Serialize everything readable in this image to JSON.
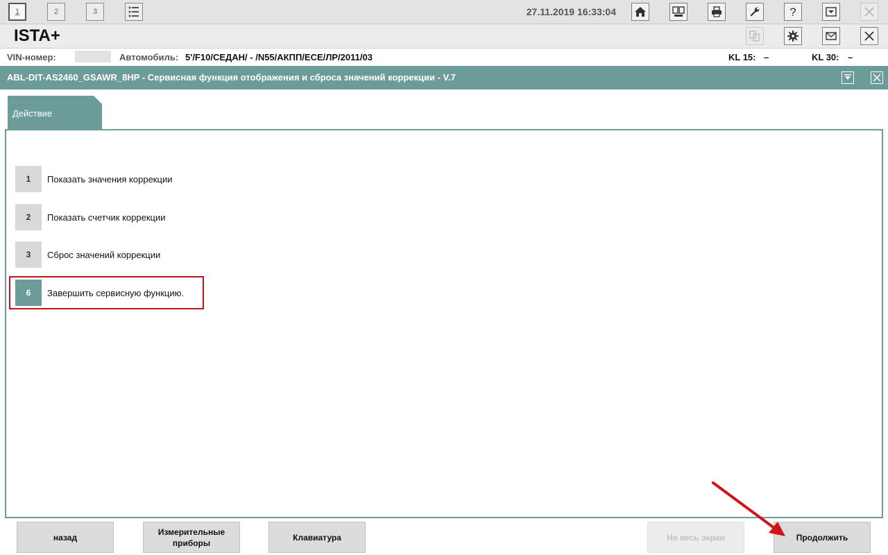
{
  "toolbar": {
    "workspaces": [
      "1",
      "2",
      "3"
    ],
    "datetime": "27.11.2019 16:33:04",
    "icons": [
      "home-icon",
      "vehicle-info-icon",
      "printer-icon",
      "wrench-icon",
      "help-icon",
      "minimize-icon",
      "close-icon"
    ]
  },
  "titlebar": {
    "app_name": "ISTA+",
    "icons": [
      "copy-icon",
      "settings-gear-icon",
      "mail-icon",
      "close-icon"
    ]
  },
  "infobar": {
    "vin_label": "VIN-номер:",
    "vin_value": "",
    "car_label": "Автомобиль:",
    "car_value": "5'/F10/СЕДАН/ - /N55/АКПП/ЕСЕ/ЛР/2011/03",
    "kl15_label": "KL 15:",
    "kl15_value": "–",
    "kl30_label": "KL 30:",
    "kl30_value": "–"
  },
  "function": {
    "title": "ABL-DIT-AS2460_GSAWR_8HP - Сервисная функция отображения и сброса значений коррекции - V.7"
  },
  "tab": {
    "label": "Действие"
  },
  "options": [
    {
      "num": "1",
      "label": "Показать значения коррекции"
    },
    {
      "num": "2",
      "label": "Показать счетчик коррекции"
    },
    {
      "num": "3",
      "label": "Сброс значений коррекции"
    },
    {
      "num": "6",
      "label": "Завершить сервисную функцию.",
      "selected": true
    }
  ],
  "buttons": {
    "back": "назад",
    "instruments_line1": "Измерительные",
    "instruments_line2": "приборы",
    "keyboard": "Клавиатура",
    "fullscreen": "На весь экран",
    "continue": "Продолжить"
  },
  "colors": {
    "accent": "#6b9c99",
    "highlight": "#c0141b"
  }
}
